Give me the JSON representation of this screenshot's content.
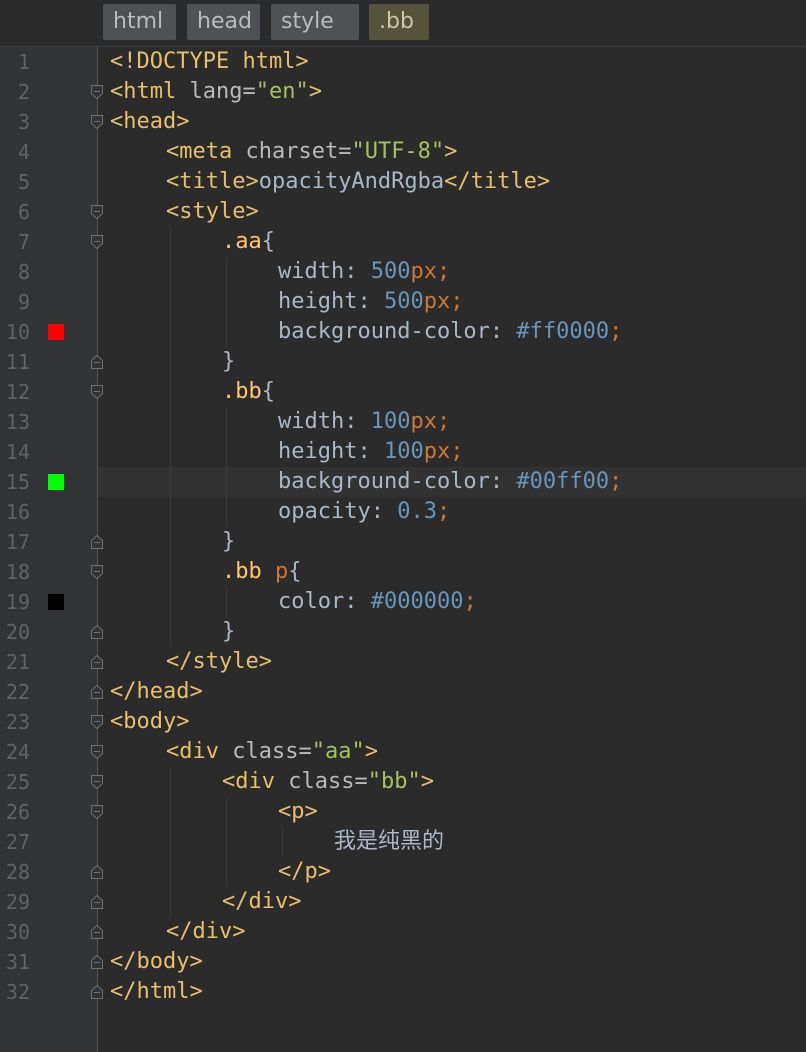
{
  "breadcrumb": {
    "items": [
      {
        "label": "html"
      },
      {
        "label": "head"
      },
      {
        "label": "style"
      },
      {
        "label": ".bb"
      }
    ]
  },
  "editor": {
    "line_numbers": [
      "1",
      "2",
      "3",
      "4",
      "5",
      "6",
      "7",
      "8",
      "9",
      "10",
      "11",
      "12",
      "13",
      "14",
      "15",
      "16",
      "17",
      "18",
      "19",
      "20",
      "21",
      "22",
      "23",
      "24",
      "25",
      "26",
      "27",
      "28",
      "29",
      "30",
      "31",
      "32"
    ],
    "color_swatches": [
      {
        "line": 10,
        "color": "#ff0000"
      },
      {
        "line": 15,
        "color": "#00ff00"
      },
      {
        "line": 19,
        "color": "#000000"
      }
    ],
    "current_line": 15,
    "lines": [
      {
        "no": 1,
        "segments": [
          {
            "c": "t",
            "v": "<!DOCTYPE html>"
          }
        ]
      },
      {
        "no": 2,
        "segments": [
          {
            "c": "t",
            "v": "<html "
          },
          {
            "c": "a",
            "v": "lang="
          },
          {
            "c": "s",
            "v": "\"en\""
          },
          {
            "c": "t",
            "v": ">"
          }
        ]
      },
      {
        "no": 3,
        "segments": [
          {
            "c": "t",
            "v": "<head>"
          }
        ]
      },
      {
        "no": 4,
        "segments": [
          {
            "c": "t",
            "v": "<meta "
          },
          {
            "c": "a",
            "v": "charset="
          },
          {
            "c": "s",
            "v": "\"UTF-8\""
          },
          {
            "c": "t",
            "v": ">"
          }
        ]
      },
      {
        "no": 5,
        "segments": [
          {
            "c": "t",
            "v": "<title>"
          },
          {
            "c": "c",
            "v": "opacityAndRgba"
          },
          {
            "c": "t",
            "v": "</title>"
          }
        ]
      },
      {
        "no": 6,
        "segments": [
          {
            "c": "t",
            "v": "<style>"
          }
        ]
      },
      {
        "no": 7,
        "segments": [
          {
            "c": "cls",
            "v": ".aa"
          },
          {
            "c": "p",
            "v": "{"
          }
        ]
      },
      {
        "no": 8,
        "segments": [
          {
            "c": "c",
            "v": "width: "
          },
          {
            "c": "n",
            "v": "500"
          },
          {
            "c": "k",
            "v": "px"
          },
          {
            "c": "k",
            "v": ";"
          }
        ]
      },
      {
        "no": 9,
        "segments": [
          {
            "c": "c",
            "v": "height: "
          },
          {
            "c": "n",
            "v": "500"
          },
          {
            "c": "k",
            "v": "px"
          },
          {
            "c": "k",
            "v": ";"
          }
        ]
      },
      {
        "no": 10,
        "segments": [
          {
            "c": "c",
            "v": "background-color: "
          },
          {
            "c": "n",
            "v": "#ff0000"
          },
          {
            "c": "k",
            "v": ";"
          }
        ]
      },
      {
        "no": 11,
        "segments": [
          {
            "c": "p",
            "v": "}"
          }
        ]
      },
      {
        "no": 12,
        "segments": [
          {
            "c": "cls",
            "v": ".bb"
          },
          {
            "c": "p",
            "v": "{"
          }
        ]
      },
      {
        "no": 13,
        "segments": [
          {
            "c": "c",
            "v": "width: "
          },
          {
            "c": "n",
            "v": "100"
          },
          {
            "c": "k",
            "v": "px"
          },
          {
            "c": "k",
            "v": ";"
          }
        ]
      },
      {
        "no": 14,
        "segments": [
          {
            "c": "c",
            "v": "height: "
          },
          {
            "c": "n",
            "v": "100"
          },
          {
            "c": "k",
            "v": "px"
          },
          {
            "c": "k",
            "v": ";"
          }
        ]
      },
      {
        "no": 15,
        "segments": [
          {
            "c": "c",
            "v": "background-color"
          },
          {
            "c": "c",
            "v": ": "
          },
          {
            "c": "n",
            "v": "#00ff00"
          },
          {
            "c": "k",
            "v": ";"
          }
        ]
      },
      {
        "no": 16,
        "segments": [
          {
            "c": "c",
            "v": "opacity: "
          },
          {
            "c": "n",
            "v": "0.3"
          },
          {
            "c": "k",
            "v": ";"
          }
        ]
      },
      {
        "no": 17,
        "segments": [
          {
            "c": "p",
            "v": "}"
          }
        ]
      },
      {
        "no": 18,
        "segments": [
          {
            "c": "cls",
            "v": ".bb "
          },
          {
            "c": "k",
            "v": "p"
          },
          {
            "c": "p",
            "v": "{"
          }
        ]
      },
      {
        "no": 19,
        "segments": [
          {
            "c": "c",
            "v": "color: "
          },
          {
            "c": "n",
            "v": "#000000"
          },
          {
            "c": "k",
            "v": ";"
          }
        ]
      },
      {
        "no": 20,
        "segments": [
          {
            "c": "p",
            "v": "}"
          }
        ]
      },
      {
        "no": 21,
        "segments": [
          {
            "c": "t",
            "v": "</style>"
          }
        ]
      },
      {
        "no": 22,
        "segments": [
          {
            "c": "t",
            "v": "</head>"
          }
        ]
      },
      {
        "no": 23,
        "segments": [
          {
            "c": "t",
            "v": "<body>"
          }
        ]
      },
      {
        "no": 24,
        "segments": [
          {
            "c": "t",
            "v": "<div "
          },
          {
            "c": "a",
            "v": "class="
          },
          {
            "c": "s",
            "v": "\"aa\""
          },
          {
            "c": "t",
            "v": ">"
          }
        ]
      },
      {
        "no": 25,
        "segments": [
          {
            "c": "t",
            "v": "<div "
          },
          {
            "c": "a",
            "v": "class="
          },
          {
            "c": "s",
            "v": "\"bb\""
          },
          {
            "c": "t",
            "v": ">"
          }
        ]
      },
      {
        "no": 26,
        "segments": [
          {
            "c": "t",
            "v": "<p>"
          }
        ]
      },
      {
        "no": 27,
        "segments": [
          {
            "c": "u",
            "v": "我是纯黑的"
          }
        ]
      },
      {
        "no": 28,
        "segments": [
          {
            "c": "t",
            "v": "</p>"
          }
        ]
      },
      {
        "no": 29,
        "segments": [
          {
            "c": "t",
            "v": "</div>"
          }
        ]
      },
      {
        "no": 30,
        "segments": [
          {
            "c": "t",
            "v": "</div>"
          }
        ]
      },
      {
        "no": 31,
        "segments": [
          {
            "c": "t",
            "v": "</body>"
          }
        ]
      },
      {
        "no": 32,
        "segments": [
          {
            "c": "t",
            "v": "</html>"
          }
        ]
      }
    ]
  }
}
